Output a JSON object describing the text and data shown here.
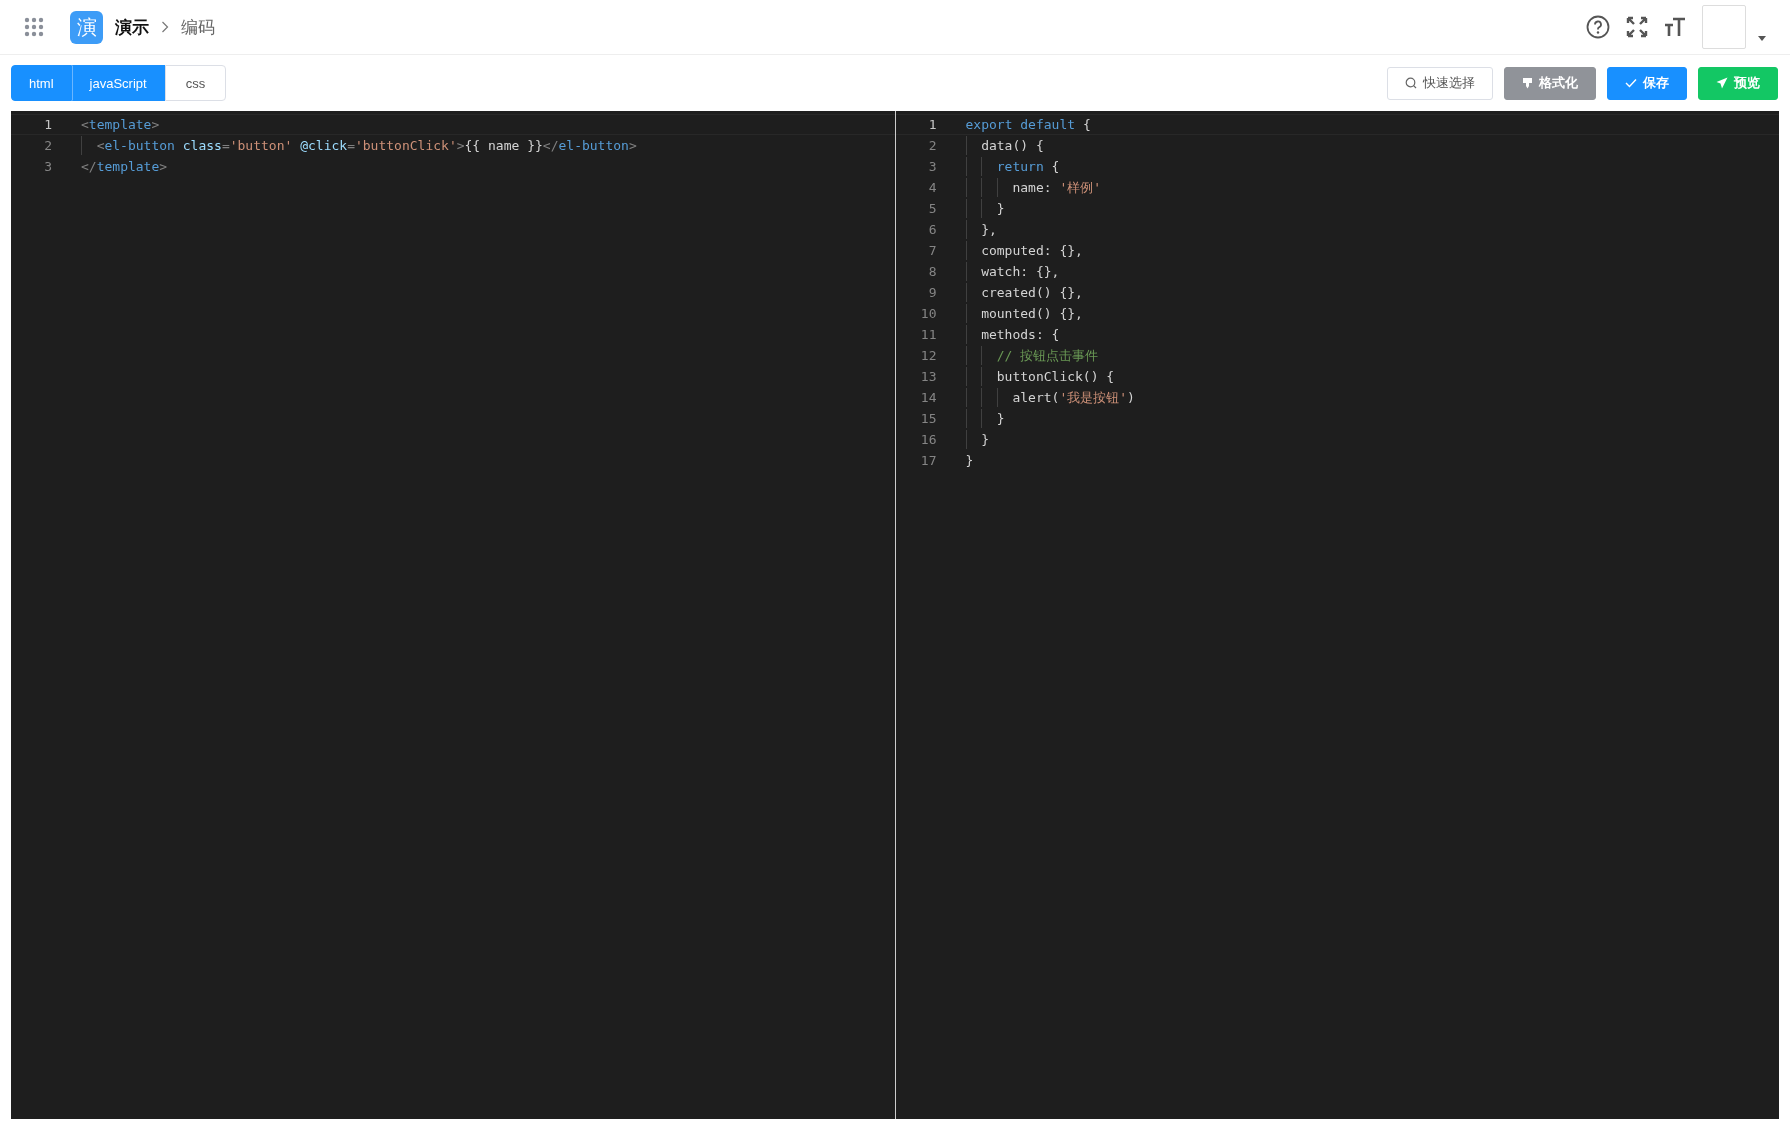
{
  "header": {
    "logo": "演",
    "app_name": "演示",
    "breadcrumb": "编码"
  },
  "tabs": [
    {
      "label": "html",
      "selected": true
    },
    {
      "label": "javaScript",
      "selected": true
    },
    {
      "label": "css",
      "selected": false
    }
  ],
  "actions": [
    {
      "kind": "search",
      "label": "快速选择"
    },
    {
      "kind": "format",
      "label": "格式化"
    },
    {
      "kind": "save",
      "label": "保存"
    },
    {
      "kind": "preview",
      "label": "预览"
    }
  ],
  "editors": [
    {
      "lines": [
        {
          "number": "1",
          "active": true,
          "tokens": [
            {
              "kind": "bracket",
              "text": "<"
            },
            {
              "kind": "tag",
              "text": "template"
            },
            {
              "kind": "bracket",
              "text": ">"
            }
          ]
        },
        {
          "number": "2",
          "active": false,
          "tokens": [
            {
              "kind": "bracket",
              "text": "  <"
            },
            {
              "kind": "tag",
              "text": "el-button"
            },
            {
              "kind": "attr",
              "text": " class"
            },
            {
              "kind": "bracket",
              "text": "="
            },
            {
              "kind": "string",
              "text": "'button'"
            },
            {
              "kind": "attr",
              "text": " @click"
            },
            {
              "kind": "bracket",
              "text": "="
            },
            {
              "kind": "string",
              "text": "'buttonClick'"
            },
            {
              "kind": "bracket",
              "text": ">"
            },
            {
              "kind": "text",
              "text": "{{ name }}"
            },
            {
              "kind": "bracket",
              "text": "</"
            },
            {
              "kind": "tag",
              "text": "el-button"
            },
            {
              "kind": "bracket",
              "text": ">"
            }
          ]
        },
        {
          "number": "3",
          "active": false,
          "tokens": [
            {
              "kind": "bracket",
              "text": "</"
            },
            {
              "kind": "tag",
              "text": "template"
            },
            {
              "kind": "bracket",
              "text": ">"
            }
          ]
        }
      ]
    },
    {
      "lines": [
        {
          "number": "1",
          "active": true,
          "tokens": [
            {
              "kind": "keyword",
              "text": "export default"
            },
            {
              "kind": "text",
              "text": " {"
            }
          ]
        },
        {
          "number": "2",
          "active": false,
          "tokens": [
            {
              "kind": "text",
              "text": "  data() {"
            }
          ]
        },
        {
          "number": "3",
          "active": false,
          "tokens": [
            {
              "kind": "keyword",
              "text": "    return"
            },
            {
              "kind": "text",
              "text": " {"
            }
          ]
        },
        {
          "number": "4",
          "active": false,
          "tokens": [
            {
              "kind": "text",
              "text": "      name: "
            },
            {
              "kind": "string",
              "text": "'样例'"
            }
          ]
        },
        {
          "number": "5",
          "active": false,
          "tokens": [
            {
              "kind": "text",
              "text": "    }"
            }
          ]
        },
        {
          "number": "6",
          "active": false,
          "tokens": [
            {
              "kind": "text",
              "text": "  },"
            }
          ]
        },
        {
          "number": "7",
          "active": false,
          "tokens": [
            {
              "kind": "text",
              "text": "  computed: {},"
            }
          ]
        },
        {
          "number": "8",
          "active": false,
          "tokens": [
            {
              "kind": "text",
              "text": "  watch: {},"
            }
          ]
        },
        {
          "number": "9",
          "active": false,
          "tokens": [
            {
              "kind": "text",
              "text": "  created() {},"
            }
          ]
        },
        {
          "number": "10",
          "active": false,
          "tokens": [
            {
              "kind": "text",
              "text": "  mounted() {},"
            }
          ]
        },
        {
          "number": "11",
          "active": false,
          "tokens": [
            {
              "kind": "text",
              "text": "  methods: {"
            }
          ]
        },
        {
          "number": "12",
          "active": false,
          "tokens": [
            {
              "kind": "comment",
              "text": "    // 按钮点击事件"
            }
          ]
        },
        {
          "number": "13",
          "active": false,
          "tokens": [
            {
              "kind": "text",
              "text": "    buttonClick() {"
            }
          ]
        },
        {
          "number": "14",
          "active": false,
          "tokens": [
            {
              "kind": "text",
              "text": "      alert("
            },
            {
              "kind": "string",
              "text": "'我是按钮'"
            },
            {
              "kind": "text",
              "text": ")"
            }
          ]
        },
        {
          "number": "15",
          "active": false,
          "tokens": [
            {
              "kind": "text",
              "text": "    }"
            }
          ]
        },
        {
          "number": "16",
          "active": false,
          "tokens": [
            {
              "kind": "text",
              "text": "  }"
            }
          ]
        },
        {
          "number": "17",
          "active": false,
          "tokens": [
            {
              "kind": "text",
              "text": "}"
            }
          ]
        }
      ]
    }
  ]
}
